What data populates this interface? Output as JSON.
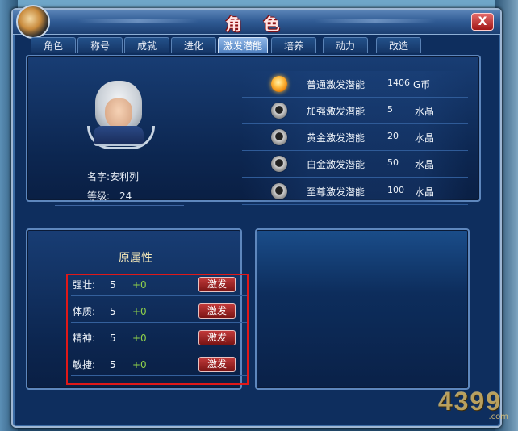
{
  "window": {
    "title": "角 色"
  },
  "tabs": [
    {
      "label": "角色",
      "active": false
    },
    {
      "label": "称号",
      "active": false
    },
    {
      "label": "成就",
      "active": false
    },
    {
      "label": "进化",
      "active": false
    },
    {
      "label": "激发潜能",
      "active": true
    },
    {
      "label": "培养",
      "active": false
    },
    {
      "label": "动力",
      "active": false
    },
    {
      "label": "改造",
      "active": false
    }
  ],
  "character": {
    "name_label": "名字:",
    "name": "安利列",
    "level_label": "等级:",
    "level": "24"
  },
  "potentials": [
    {
      "name": "普通激发潜能",
      "cost": "1406",
      "unit": "G币",
      "selected": true
    },
    {
      "name": "加强激发潜能",
      "cost": "5",
      "unit": "水晶",
      "selected": false
    },
    {
      "name": "黄金激发潜能",
      "cost": "20",
      "unit": "水晶",
      "selected": false
    },
    {
      "name": "白金激发潜能",
      "cost": "50",
      "unit": "水晶",
      "selected": false
    },
    {
      "name": "至尊激发潜能",
      "cost": "100",
      "unit": "水晶",
      "selected": false
    }
  ],
  "attributes": {
    "title": "原属性",
    "items": [
      {
        "name": "强壮:",
        "value": "5",
        "bonus": "+0",
        "button": "激发"
      },
      {
        "name": "体质:",
        "value": "5",
        "bonus": "+0",
        "button": "激发"
      },
      {
        "name": "精神:",
        "value": "5",
        "bonus": "+0",
        "button": "激发"
      },
      {
        "name": "敏捷:",
        "value": "5",
        "bonus": "+0",
        "button": "激发"
      }
    ]
  },
  "close_label": "X",
  "watermark": "4399",
  "watermark_sub": ".com",
  "colors": {
    "accent": "#e01818",
    "selected": "#ffc34a",
    "bonus": "#8fd14a"
  }
}
